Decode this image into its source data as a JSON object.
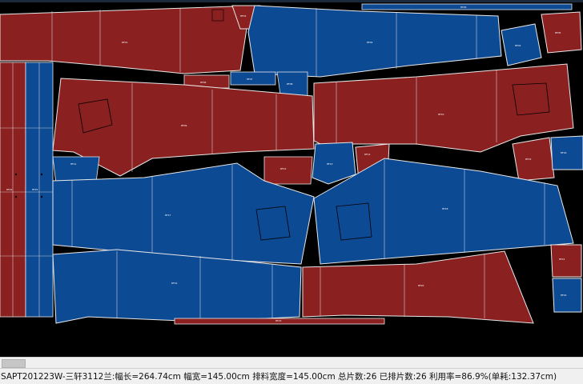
{
  "colors": {
    "red_piece": "#8b2020",
    "blue_piece": "#0d4a94",
    "outline": "#e8e8e8",
    "background": "#000000"
  },
  "status": {
    "text": "SAPT201223W-三轩3112兰:幅长=264.74cm  幅宽=145.00cm  排料宽度=145.00cm  总片数:26  已排片数:26  利用率=86.9%(单耗:132.37cm)"
  },
  "pieces": {
    "labels": [
      "8F01",
      "8F02",
      "8F03",
      "8F04",
      "8F05",
      "8F06",
      "8F07",
      "8F08",
      "8F09",
      "8F10",
      "8F11",
      "8F12",
      "8F13",
      "8F14",
      "8F15",
      "8F16",
      "8F17",
      "8F18",
      "8F19",
      "8F20",
      "8F21",
      "8F22",
      "8F23",
      "8F24",
      "8F25",
      "8F26"
    ]
  }
}
